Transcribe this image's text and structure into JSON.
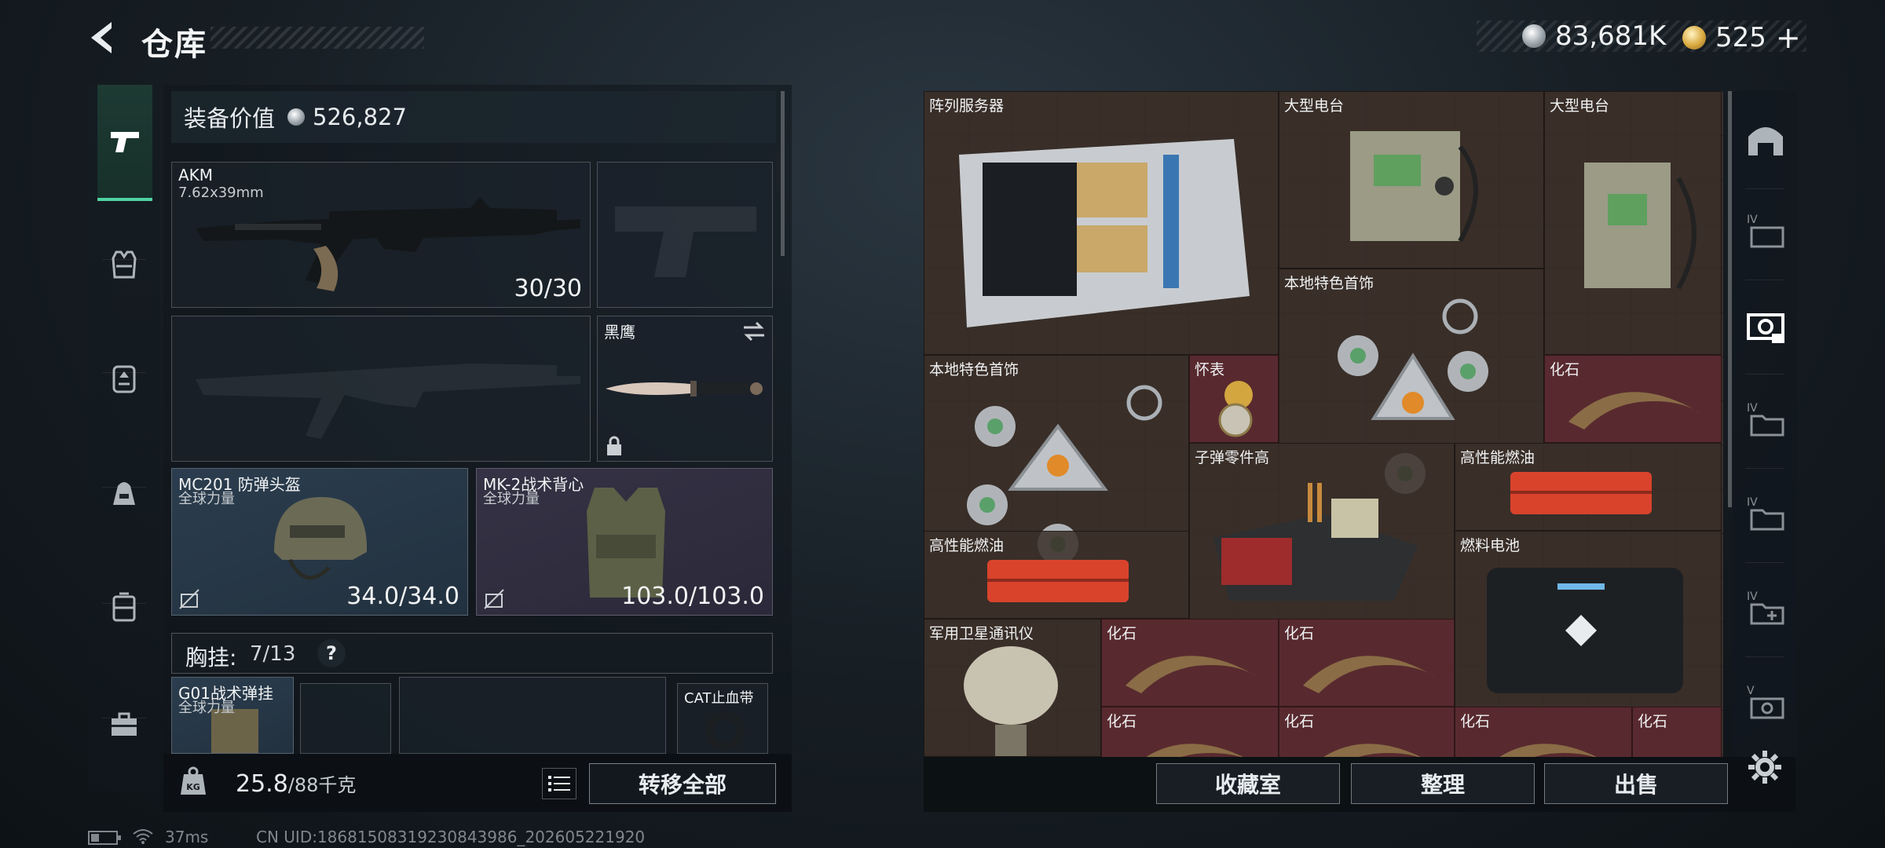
{
  "header": {
    "title": "仓库",
    "currency_silver": "83,681K",
    "currency_gold": "525",
    "currency_gold_add": "+"
  },
  "loadout": {
    "equipment_value_label": "装备价值",
    "equipment_value": "526,827",
    "primary": {
      "name": "AKM",
      "ammo_type": "7.62x39mm",
      "ammo": "30/30"
    },
    "melee": {
      "name": "黑鹰"
    },
    "helmet": {
      "name": "MC201 防弹头盔",
      "brand": "全球力量",
      "durability": "34.0/34.0"
    },
    "vest": {
      "name": "MK-2战术背心",
      "brand": "全球力量",
      "durability": "103.0/103.0"
    },
    "chest_rig_label": "胸挂:",
    "chest_rig_count": "7/13",
    "chest_rig_help": "?",
    "rig_items": [
      {
        "name": "G01战术弹挂",
        "brand": "全球力量"
      },
      {
        "name": "CAT止血带"
      }
    ],
    "weight_value": "25.8",
    "weight_max": "/88千克",
    "transfer_all_label": "转移全部"
  },
  "stash": {
    "items": [
      {
        "label": "阵列服务器",
        "rarity": "normal"
      },
      {
        "label": "大型电台",
        "rarity": "normal"
      },
      {
        "label": "大型电台",
        "rarity": "normal"
      },
      {
        "label": "本地特色首饰",
        "rarity": "normal"
      },
      {
        "label": "本地特色首饰",
        "rarity": "normal"
      },
      {
        "label": "怀表",
        "rarity": "red"
      },
      {
        "label": "化石",
        "rarity": "red"
      },
      {
        "label": "子弹零件高",
        "rarity": "normal"
      },
      {
        "label": "高性能燃油",
        "rarity": "normal"
      },
      {
        "label": "高性能燃油",
        "rarity": "normal"
      },
      {
        "label": "燃料电池",
        "rarity": "normal"
      },
      {
        "label": "军用卫星通讯仪",
        "rarity": "normal"
      },
      {
        "label": "化石",
        "rarity": "red"
      },
      {
        "label": "化石",
        "rarity": "red"
      },
      {
        "label": "化石",
        "rarity": "red"
      },
      {
        "label": "化石",
        "rarity": "red"
      },
      {
        "label": "化石",
        "rarity": "red"
      },
      {
        "label": "化石",
        "rarity": "red"
      }
    ],
    "buttons": {
      "collection": "收藏室",
      "organize": "整理",
      "sell": "出售"
    }
  },
  "right_nav": {
    "tiers": [
      "IV",
      "IV",
      "IV",
      "IV",
      "V"
    ]
  },
  "status_bar": {
    "ping": "37ms",
    "uid": "CN UID:18681508319230843986_202605221920"
  },
  "colors": {
    "accent_green": "#4fd3a4",
    "stash_brown": "#3a302a",
    "rarity_red": "#5c2a30",
    "slot_blue": "#2b3d4e",
    "slot_purple": "#343244"
  }
}
